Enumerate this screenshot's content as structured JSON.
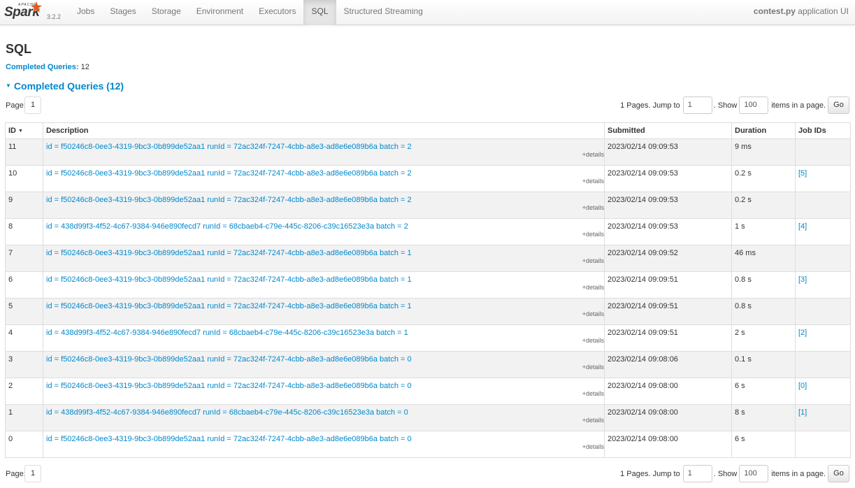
{
  "navbar": {
    "brand": {
      "apache": "APACHE",
      "name": "Spark",
      "version": "3.2.2"
    },
    "tabs": [
      {
        "label": "Jobs",
        "active": false
      },
      {
        "label": "Stages",
        "active": false
      },
      {
        "label": "Storage",
        "active": false
      },
      {
        "label": "Environment",
        "active": false
      },
      {
        "label": "Executors",
        "active": false
      },
      {
        "label": "SQL",
        "active": true
      },
      {
        "label": "Structured Streaming",
        "active": false
      }
    ],
    "app_name": "contest.py",
    "app_suffix": "application UI"
  },
  "page": {
    "title": "SQL",
    "summary_key": "Completed Queries:",
    "summary_value": "12",
    "section_title": "Completed Queries (12)"
  },
  "paging": {
    "page_label": "Page:",
    "page_number": "1",
    "pages_text": "1 Pages. Jump to",
    "jump_value": "1",
    "show_text": ". Show",
    "show_value": "100",
    "items_text": "items in a page.",
    "go_label": "Go"
  },
  "table": {
    "headers": {
      "id": "ID",
      "description": "Description",
      "submitted": "Submitted",
      "duration": "Duration",
      "job_ids": "Job IDs"
    },
    "details_label": "+details",
    "rows": [
      {
        "id": "11",
        "description": "id = f50246c8-0ee3-4319-9bc3-0b899de52aa1 runId = 72ac324f-7247-4cbb-a8e3-ad8e6e089b6a batch = 2",
        "submitted": "2023/02/14 09:09:53",
        "duration": "9 ms",
        "job_ids": ""
      },
      {
        "id": "10",
        "description": "id = f50246c8-0ee3-4319-9bc3-0b899de52aa1 runId = 72ac324f-7247-4cbb-a8e3-ad8e6e089b6a batch = 2",
        "submitted": "2023/02/14 09:09:53",
        "duration": "0.2 s",
        "job_ids": "[5]"
      },
      {
        "id": "9",
        "description": "id = f50246c8-0ee3-4319-9bc3-0b899de52aa1 runId = 72ac324f-7247-4cbb-a8e3-ad8e6e089b6a batch = 2",
        "submitted": "2023/02/14 09:09:53",
        "duration": "0.2 s",
        "job_ids": ""
      },
      {
        "id": "8",
        "description": "id = 438d99f3-4f52-4c67-9384-946e890fecd7 runId = 68cbaeb4-c79e-445c-8206-c39c16523e3a batch = 2",
        "submitted": "2023/02/14 09:09:53",
        "duration": "1 s",
        "job_ids": "[4]"
      },
      {
        "id": "7",
        "description": "id = f50246c8-0ee3-4319-9bc3-0b899de52aa1 runId = 72ac324f-7247-4cbb-a8e3-ad8e6e089b6a batch = 1",
        "submitted": "2023/02/14 09:09:52",
        "duration": "46 ms",
        "job_ids": ""
      },
      {
        "id": "6",
        "description": "id = f50246c8-0ee3-4319-9bc3-0b899de52aa1 runId = 72ac324f-7247-4cbb-a8e3-ad8e6e089b6a batch = 1",
        "submitted": "2023/02/14 09:09:51",
        "duration": "0.8 s",
        "job_ids": "[3]"
      },
      {
        "id": "5",
        "description": "id = f50246c8-0ee3-4319-9bc3-0b899de52aa1 runId = 72ac324f-7247-4cbb-a8e3-ad8e6e089b6a batch = 1",
        "submitted": "2023/02/14 09:09:51",
        "duration": "0.8 s",
        "job_ids": ""
      },
      {
        "id": "4",
        "description": "id = 438d99f3-4f52-4c67-9384-946e890fecd7 runId = 68cbaeb4-c79e-445c-8206-c39c16523e3a batch = 1",
        "submitted": "2023/02/14 09:09:51",
        "duration": "2 s",
        "job_ids": "[2]"
      },
      {
        "id": "3",
        "description": "id = f50246c8-0ee3-4319-9bc3-0b899de52aa1 runId = 72ac324f-7247-4cbb-a8e3-ad8e6e089b6a batch = 0",
        "submitted": "2023/02/14 09:08:06",
        "duration": "0.1 s",
        "job_ids": ""
      },
      {
        "id": "2",
        "description": "id = f50246c8-0ee3-4319-9bc3-0b899de52aa1 runId = 72ac324f-7247-4cbb-a8e3-ad8e6e089b6a batch = 0",
        "submitted": "2023/02/14 09:08:00",
        "duration": "6 s",
        "job_ids": "[0]"
      },
      {
        "id": "1",
        "description": "id = 438d99f3-4f52-4c67-9384-946e890fecd7 runId = 68cbaeb4-c79e-445c-8206-c39c16523e3a batch = 0",
        "submitted": "2023/02/14 09:08:00",
        "duration": "8 s",
        "job_ids": "[1]"
      },
      {
        "id": "0",
        "description": "id = f50246c8-0ee3-4319-9bc3-0b899de52aa1 runId = 72ac324f-7247-4cbb-a8e3-ad8e6e089b6a batch = 0",
        "submitted": "2023/02/14 09:08:00",
        "duration": "6 s",
        "job_ids": ""
      }
    ]
  },
  "colors": {
    "link": "#0088cc",
    "stripe": "#f2f2f2",
    "border": "#dddddd",
    "spark_star": "#e25a1c"
  }
}
